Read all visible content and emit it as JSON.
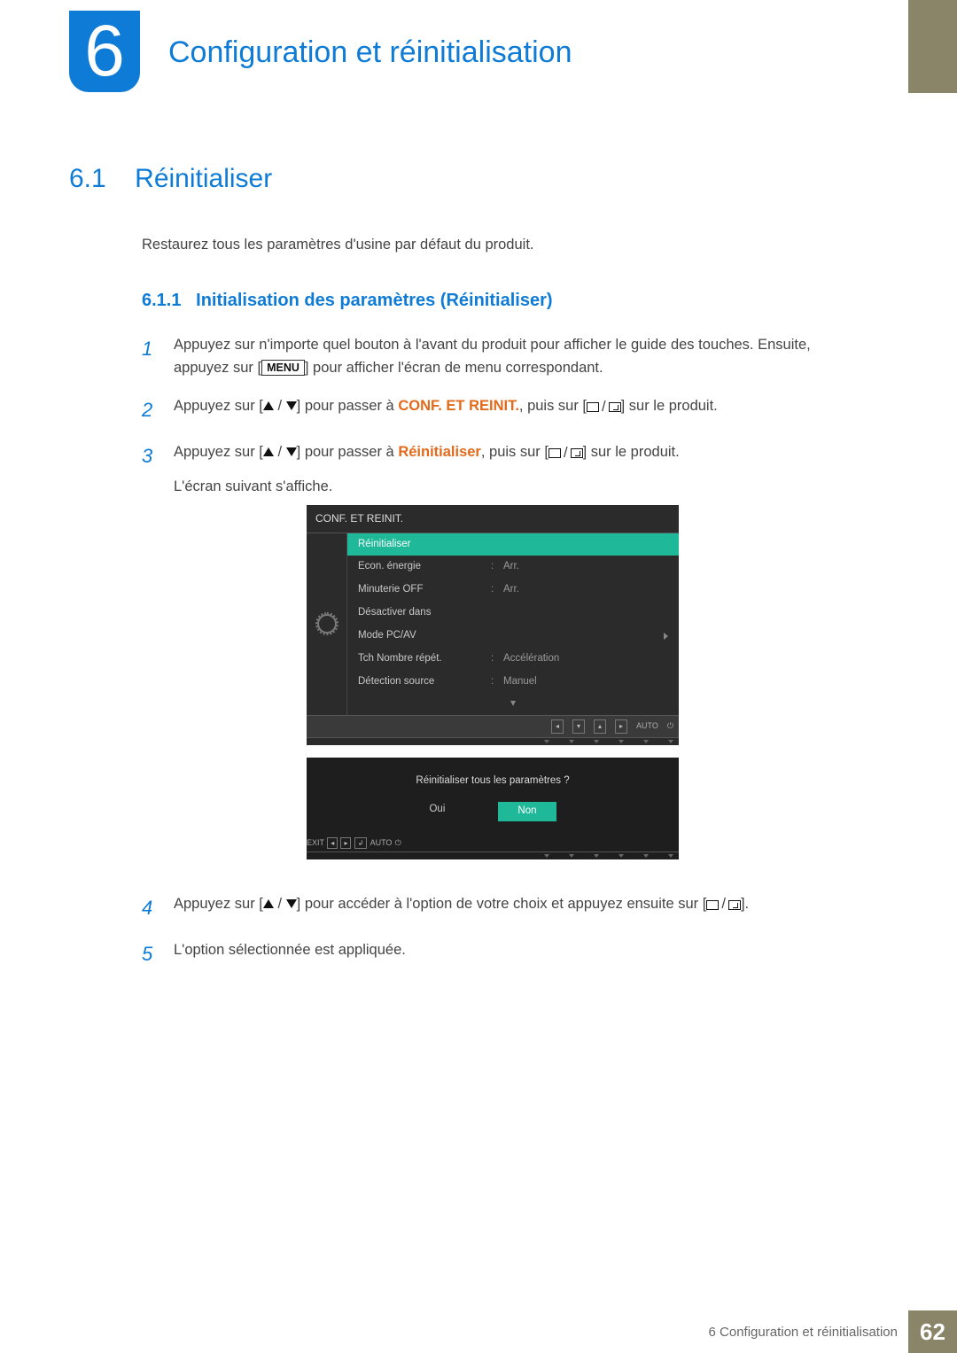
{
  "chapter": {
    "number": "6",
    "title": "Configuration et réinitialisation"
  },
  "section": {
    "number": "6.1",
    "title": "Réinitialiser"
  },
  "intro": "Restaurez tous les paramètres d'usine par défaut du produit.",
  "subsection": {
    "number": "6.1.1",
    "title": "Initialisation des paramètres (Réinitialiser)"
  },
  "steps": {
    "s1a": "Appuyez sur n'importe quel bouton à l'avant du produit pour afficher le guide des touches. Ensuite, appuyez sur [",
    "s1b": "] pour afficher l'écran de menu correspondant.",
    "s2a": "Appuyez sur [",
    "s2b": "] pour passer à ",
    "s2c": ", puis sur [",
    "s2d": "] sur le produit.",
    "s3a": "Appuyez sur [",
    "s3b": "] pour passer à ",
    "s3c": ", puis sur [",
    "s3d": "] sur le produit.",
    "s3e": "L'écran suivant s'affiche.",
    "s4a": "Appuyez sur [",
    "s4b": "] pour accéder à l'option de votre choix et appuyez ensuite sur [",
    "s4c": "].",
    "s5": "L'option sélectionnée est appliquée."
  },
  "labels": {
    "menu": "MENU",
    "conf": "CONF. ET REINIT.",
    "reinit": "Réinitialiser"
  },
  "osd": {
    "title": "CONF. ET REINIT.",
    "rows": [
      {
        "label": "Réinitialiser",
        "value": "",
        "selected": true
      },
      {
        "label": "Econ. énergie",
        "value": "Arr."
      },
      {
        "label": "Minuterie OFF",
        "value": "Arr."
      },
      {
        "label": "Désactiver dans",
        "value": ""
      },
      {
        "label": "Mode PC/AV",
        "value": "",
        "arrow": true
      },
      {
        "label": "Tch Nombre répét.",
        "value": "Accélération"
      },
      {
        "label": "Détection source",
        "value": "Manuel"
      }
    ],
    "nav": {
      "auto": "AUTO"
    }
  },
  "osd2": {
    "question": "Réinitialiser tous les paramètres ?",
    "yes": "Oui",
    "no": "Non",
    "exit": "EXIT",
    "auto": "AUTO"
  },
  "footer": {
    "text": "6 Configuration et réinitialisation",
    "page": "62"
  }
}
